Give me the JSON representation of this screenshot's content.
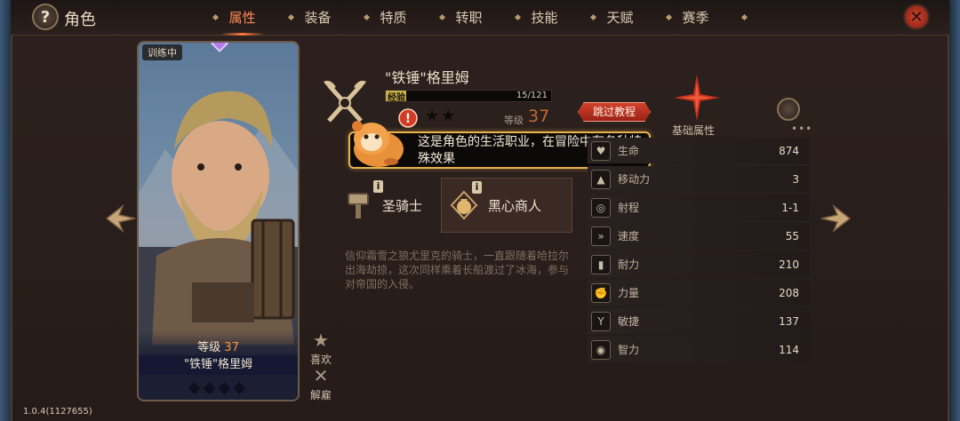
{
  "header": {
    "help_badge": "?",
    "title": "角色",
    "close_glyph": "✕"
  },
  "tabs": [
    {
      "label": "属性",
      "active": true
    },
    {
      "label": "装备",
      "active": false
    },
    {
      "label": "特质",
      "active": false
    },
    {
      "label": "转职",
      "active": false
    },
    {
      "label": "技能",
      "active": false
    },
    {
      "label": "天赋",
      "active": false
    },
    {
      "label": "赛季",
      "active": false
    }
  ],
  "card": {
    "tag": "训练中",
    "level_label": "等级",
    "level_value": "37",
    "name": "\"铁锤\"格里姆",
    "stars": "◆◆◆◆"
  },
  "hero": {
    "name": "\"铁锤\"格里姆",
    "exp_label": "经验",
    "exp_value": "15/121",
    "exp_ratio": 0.124,
    "rank_stars": "★★",
    "level_label": "等级",
    "level_value": "37"
  },
  "skip_button": "跳过教程",
  "tooltip": {
    "text": "这是角色的生活职业，在冒险中有各种特殊效果",
    "alert_glyph": "!"
  },
  "jobs": [
    {
      "label": "圣骑士",
      "info": "i"
    },
    {
      "label": "黑心商人",
      "info": "i"
    }
  ],
  "description": "信仰霜雪之狼尤里克的骑士，一直跟随着哈拉尔出海劫掠，这次同样乘着长船渡过了冰海，参与对帝国的入侵。",
  "base_attributes": {
    "title": "基础属性",
    "more": "•••",
    "stats": [
      {
        "icon": "heart-icon",
        "glyph": "♥",
        "name": "生命",
        "value": "874"
      },
      {
        "icon": "boot-icon",
        "glyph": "▲",
        "name": "移动力",
        "value": "3"
      },
      {
        "icon": "target-icon",
        "glyph": "◎",
        "name": "射程",
        "value": "1-1"
      },
      {
        "icon": "speed-icon",
        "glyph": "»",
        "name": "速度",
        "value": "55"
      },
      {
        "icon": "stamina-icon",
        "glyph": "▮",
        "name": "耐力",
        "value": "210"
      },
      {
        "icon": "strength-icon",
        "glyph": "✊",
        "name": "力量",
        "value": "208"
      },
      {
        "icon": "agility-icon",
        "glyph": "Y",
        "name": "敏捷",
        "value": "137"
      },
      {
        "icon": "intellect-icon",
        "glyph": "◉",
        "name": "智力",
        "value": "114"
      }
    ]
  },
  "actions": {
    "favorite_label": "喜欢",
    "favorite_glyph": "★",
    "dismiss_label": "解雇",
    "dismiss_glyph": "✕"
  },
  "version": "1.0.4(1127655)",
  "colors": {
    "accent": "#ff8a55",
    "tooltip_border": "#e8b24c",
    "level_orange": "#c26a32",
    "skip_red": "#c53520"
  }
}
